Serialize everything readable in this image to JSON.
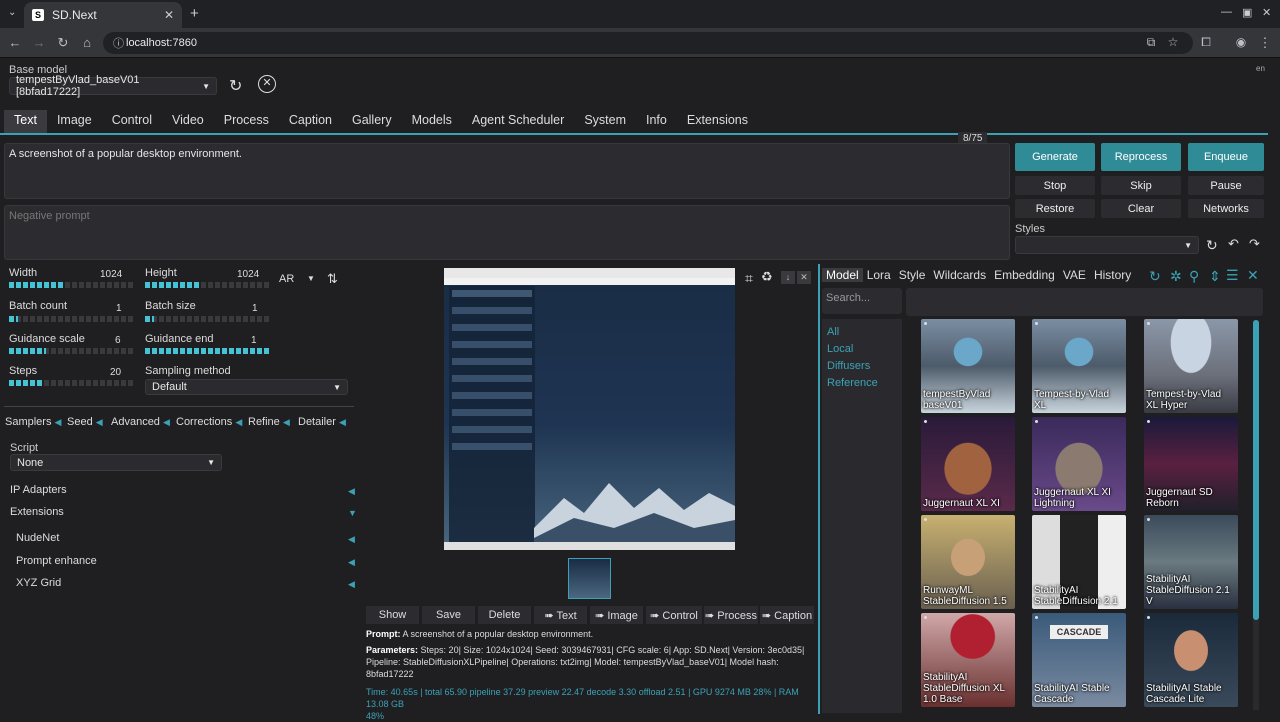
{
  "browser": {
    "tab_title": "SD.Next",
    "url": "localhost:7860"
  },
  "header": {
    "base_model_label": "Base model",
    "base_model_value": "tempestByVlad_baseV01 [8bfad17222]",
    "lang": "en"
  },
  "tabs": [
    "Text",
    "Image",
    "Control",
    "Video",
    "Process",
    "Caption",
    "Gallery",
    "Models",
    "Agent Scheduler",
    "System",
    "Info",
    "Extensions"
  ],
  "prompt": {
    "text": "A screenshot of a popular desktop environment.",
    "token_count": "8/75",
    "negative_placeholder": "Negative prompt"
  },
  "actions": {
    "generate": "Generate",
    "reprocess": "Reprocess",
    "enqueue": "Enqueue",
    "stop": "Stop",
    "skip": "Skip",
    "pause": "Pause",
    "restore": "Restore",
    "clear": "Clear",
    "networks": "Networks",
    "styles_label": "Styles"
  },
  "params": {
    "width_label": "Width",
    "width_value": "1024",
    "width_fill": 0.45,
    "height_label": "Height",
    "height_value": "1024",
    "height_fill": 0.45,
    "ar_label": "AR",
    "batch_count_label": "Batch count",
    "batch_count_value": "1",
    "batch_count_fill": 0.07,
    "batch_size_label": "Batch size",
    "batch_size_value": "1",
    "batch_size_fill": 0.07,
    "guidance_scale_label": "Guidance scale",
    "guidance_scale_value": "6",
    "guidance_scale_fill": 0.3,
    "guidance_end_label": "Guidance end",
    "guidance_end_value": "1",
    "guidance_end_fill": 1.0,
    "steps_label": "Steps",
    "steps_value": "20",
    "steps_fill": 0.28,
    "sampling_label": "Sampling method",
    "sampling_value": "Default"
  },
  "accordions": [
    "Samplers",
    "Seed",
    "Advanced",
    "Corrections",
    "Refine",
    "Detailer"
  ],
  "script": {
    "label": "Script",
    "value": "None"
  },
  "sections": {
    "ip_adapters": "IP Adapters",
    "extensions": "Extensions",
    "nudenet": "NudeNet",
    "prompt_enhance": "Prompt enhance",
    "xyz_grid": "XYZ Grid"
  },
  "gallery_buttons": [
    "Show",
    "Save",
    "Delete",
    "➠ Text",
    "➠ Image",
    "➠ Control",
    "➠ Process",
    "➠ Caption"
  ],
  "output_info": {
    "prompt_label": "Prompt:",
    "prompt_text": "A screenshot of a popular desktop environment.",
    "params_label": "Parameters:",
    "params_line1": "Steps: 20| Size: 1024x1024| Seed: 3039467931| CFG scale: 6| App: SD.Next| Version: 3ec0d35|",
    "params_line2": "Pipeline: StableDiffusionXLPipeline| Operations: txt2img| Model: tempestByVlad_baseV01| Model hash:",
    "params_line3": "8bfad17222",
    "time_line1": "Time: 40.65s | total 65.90 pipeline 37.29 preview 22.47 decode 3.30 offload 2.51 | GPU 9274 MB 28% | RAM 13.08 GB",
    "time_line2": "48%"
  },
  "networks": {
    "tabs": [
      "Model",
      "Lora",
      "Style",
      "Wildcards",
      "Embedding",
      "VAE",
      "History"
    ],
    "search_placeholder": "Search...",
    "filters": [
      "All",
      "Local",
      "Diffusers",
      "Reference"
    ],
    "cards": [
      {
        "l1": "tempestByVlad",
        "l2": "baseV01"
      },
      {
        "l1": "Tempest-by-Vlad",
        "l2": "XL"
      },
      {
        "l1": "Tempest-by-Vlad",
        "l2": "XL Hyper"
      },
      {
        "l1": "Juggernaut XL XI",
        "l2": ""
      },
      {
        "l1": "Juggernaut XL XI",
        "l2": "Lightning"
      },
      {
        "l1": "Juggernaut SD",
        "l2": "Reborn"
      },
      {
        "l1": "RunwayML",
        "l2": "StableDiffusion 1.5"
      },
      {
        "l1": "StabilityAI",
        "l2": "StableDiffusion 2.1"
      },
      {
        "l1": "StabilityAI",
        "l2": "StableDiffusion 2.1 V"
      },
      {
        "l1": "StabilityAI",
        "l2": "StableDiffusion XL 1.0 Base"
      },
      {
        "l1": "StabilityAI Stable",
        "l2": "Cascade"
      },
      {
        "l1": "StabilityAI Stable",
        "l2": "Cascade Lite"
      }
    ],
    "cascade_sign": "CASCADE"
  }
}
